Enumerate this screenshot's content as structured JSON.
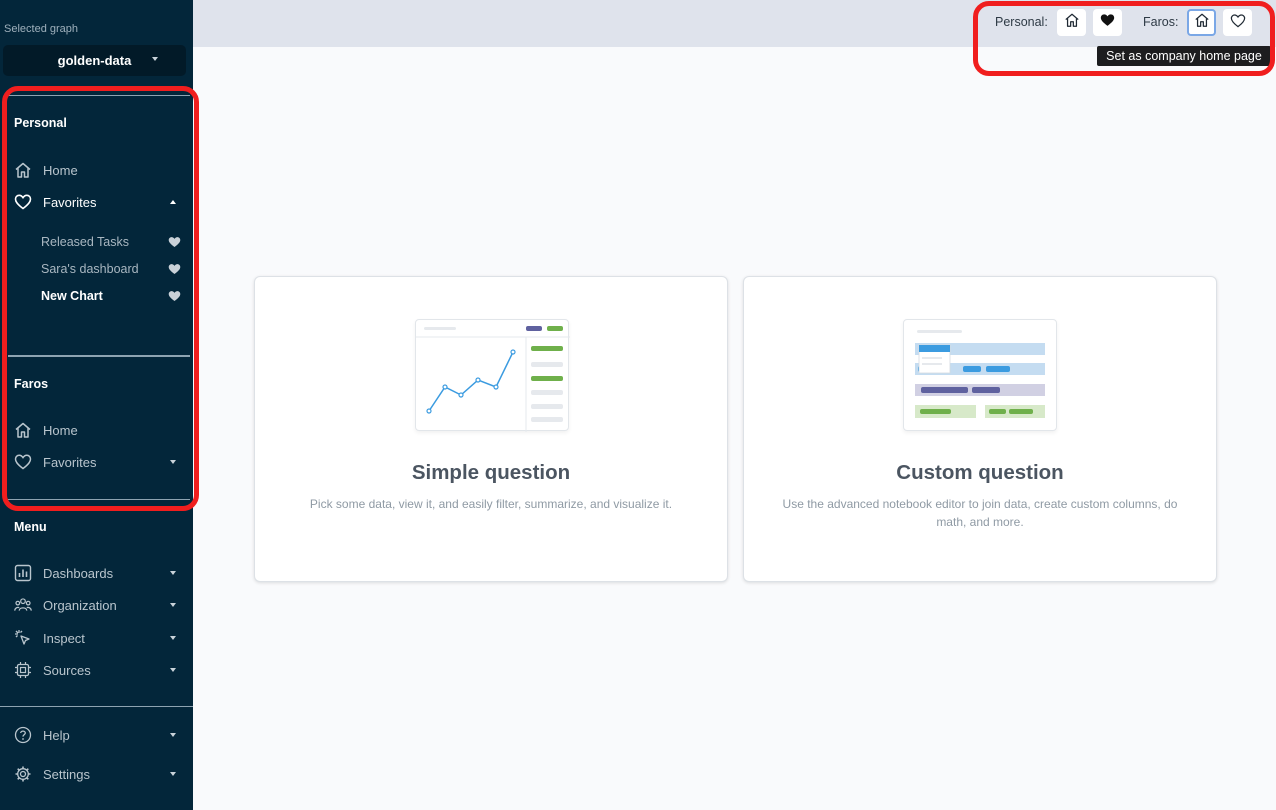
{
  "sidebar": {
    "graph_label": "Selected graph",
    "graph_value": "golden-data",
    "personal": {
      "title": "Personal",
      "home": "Home",
      "favorites": "Favorites",
      "favorite_items": [
        "Released Tasks",
        "Sara's dashboard",
        "New Chart"
      ]
    },
    "faros": {
      "title": "Faros",
      "home": "Home",
      "favorites": "Favorites"
    },
    "menu": {
      "title": "Menu",
      "items": [
        "Dashboards",
        "Organization",
        "Inspect",
        "Sources"
      ]
    },
    "help": "Help",
    "settings": "Settings"
  },
  "topbar": {
    "personal_label": "Personal:",
    "faros_label": "Faros:",
    "tooltip": "Set as company home page"
  },
  "cards": [
    {
      "title": "Simple question",
      "description": "Pick some data, view it, and easily filter, summarize, and visualize it."
    },
    {
      "title": "Custom question",
      "description": "Use the advanced notebook editor to join data, create custom columns, do math, and more."
    }
  ],
  "colors": {
    "sidebar_bg": "#03263a",
    "highlight_red": "#f01e1e",
    "chart_blue": "#3b9be0",
    "chart_green": "#6fb04b",
    "chart_purple": "#5f619f"
  }
}
